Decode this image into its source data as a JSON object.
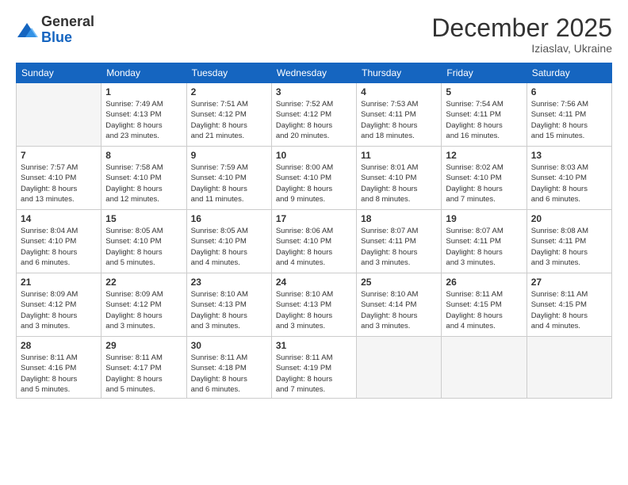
{
  "logo": {
    "general": "General",
    "blue": "Blue"
  },
  "header": {
    "month": "December 2025",
    "location": "Iziaslav, Ukraine"
  },
  "weekdays": [
    "Sunday",
    "Monday",
    "Tuesday",
    "Wednesday",
    "Thursday",
    "Friday",
    "Saturday"
  ],
  "weeks": [
    [
      {
        "day": "",
        "info": ""
      },
      {
        "day": "1",
        "info": "Sunrise: 7:49 AM\nSunset: 4:13 PM\nDaylight: 8 hours\nand 23 minutes."
      },
      {
        "day": "2",
        "info": "Sunrise: 7:51 AM\nSunset: 4:12 PM\nDaylight: 8 hours\nand 21 minutes."
      },
      {
        "day": "3",
        "info": "Sunrise: 7:52 AM\nSunset: 4:12 PM\nDaylight: 8 hours\nand 20 minutes."
      },
      {
        "day": "4",
        "info": "Sunrise: 7:53 AM\nSunset: 4:11 PM\nDaylight: 8 hours\nand 18 minutes."
      },
      {
        "day": "5",
        "info": "Sunrise: 7:54 AM\nSunset: 4:11 PM\nDaylight: 8 hours\nand 16 minutes."
      },
      {
        "day": "6",
        "info": "Sunrise: 7:56 AM\nSunset: 4:11 PM\nDaylight: 8 hours\nand 15 minutes."
      }
    ],
    [
      {
        "day": "7",
        "info": "Sunrise: 7:57 AM\nSunset: 4:10 PM\nDaylight: 8 hours\nand 13 minutes."
      },
      {
        "day": "8",
        "info": "Sunrise: 7:58 AM\nSunset: 4:10 PM\nDaylight: 8 hours\nand 12 minutes."
      },
      {
        "day": "9",
        "info": "Sunrise: 7:59 AM\nSunset: 4:10 PM\nDaylight: 8 hours\nand 11 minutes."
      },
      {
        "day": "10",
        "info": "Sunrise: 8:00 AM\nSunset: 4:10 PM\nDaylight: 8 hours\nand 9 minutes."
      },
      {
        "day": "11",
        "info": "Sunrise: 8:01 AM\nSunset: 4:10 PM\nDaylight: 8 hours\nand 8 minutes."
      },
      {
        "day": "12",
        "info": "Sunrise: 8:02 AM\nSunset: 4:10 PM\nDaylight: 8 hours\nand 7 minutes."
      },
      {
        "day": "13",
        "info": "Sunrise: 8:03 AM\nSunset: 4:10 PM\nDaylight: 8 hours\nand 6 minutes."
      }
    ],
    [
      {
        "day": "14",
        "info": "Sunrise: 8:04 AM\nSunset: 4:10 PM\nDaylight: 8 hours\nand 6 minutes."
      },
      {
        "day": "15",
        "info": "Sunrise: 8:05 AM\nSunset: 4:10 PM\nDaylight: 8 hours\nand 5 minutes."
      },
      {
        "day": "16",
        "info": "Sunrise: 8:05 AM\nSunset: 4:10 PM\nDaylight: 8 hours\nand 4 minutes."
      },
      {
        "day": "17",
        "info": "Sunrise: 8:06 AM\nSunset: 4:10 PM\nDaylight: 8 hours\nand 4 minutes."
      },
      {
        "day": "18",
        "info": "Sunrise: 8:07 AM\nSunset: 4:11 PM\nDaylight: 8 hours\nand 3 minutes."
      },
      {
        "day": "19",
        "info": "Sunrise: 8:07 AM\nSunset: 4:11 PM\nDaylight: 8 hours\nand 3 minutes."
      },
      {
        "day": "20",
        "info": "Sunrise: 8:08 AM\nSunset: 4:11 PM\nDaylight: 8 hours\nand 3 minutes."
      }
    ],
    [
      {
        "day": "21",
        "info": "Sunrise: 8:09 AM\nSunset: 4:12 PM\nDaylight: 8 hours\nand 3 minutes."
      },
      {
        "day": "22",
        "info": "Sunrise: 8:09 AM\nSunset: 4:12 PM\nDaylight: 8 hours\nand 3 minutes."
      },
      {
        "day": "23",
        "info": "Sunrise: 8:10 AM\nSunset: 4:13 PM\nDaylight: 8 hours\nand 3 minutes."
      },
      {
        "day": "24",
        "info": "Sunrise: 8:10 AM\nSunset: 4:13 PM\nDaylight: 8 hours\nand 3 minutes."
      },
      {
        "day": "25",
        "info": "Sunrise: 8:10 AM\nSunset: 4:14 PM\nDaylight: 8 hours\nand 3 minutes."
      },
      {
        "day": "26",
        "info": "Sunrise: 8:11 AM\nSunset: 4:15 PM\nDaylight: 8 hours\nand 4 minutes."
      },
      {
        "day": "27",
        "info": "Sunrise: 8:11 AM\nSunset: 4:15 PM\nDaylight: 8 hours\nand 4 minutes."
      }
    ],
    [
      {
        "day": "28",
        "info": "Sunrise: 8:11 AM\nSunset: 4:16 PM\nDaylight: 8 hours\nand 5 minutes."
      },
      {
        "day": "29",
        "info": "Sunrise: 8:11 AM\nSunset: 4:17 PM\nDaylight: 8 hours\nand 5 minutes."
      },
      {
        "day": "30",
        "info": "Sunrise: 8:11 AM\nSunset: 4:18 PM\nDaylight: 8 hours\nand 6 minutes."
      },
      {
        "day": "31",
        "info": "Sunrise: 8:11 AM\nSunset: 4:19 PM\nDaylight: 8 hours\nand 7 minutes."
      },
      {
        "day": "",
        "info": ""
      },
      {
        "day": "",
        "info": ""
      },
      {
        "day": "",
        "info": ""
      }
    ]
  ]
}
